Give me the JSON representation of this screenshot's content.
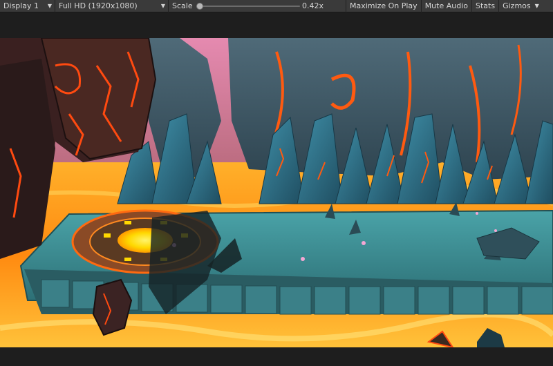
{
  "toolbar": {
    "display": "Display 1",
    "resolution": "Full HD (1920x1080)",
    "scale_label": "Scale",
    "scale_value": "0.42x",
    "scale_fraction": 0.0,
    "maximize_on_play": "Maximize On Play",
    "mute_audio": "Mute Audio",
    "stats": "Stats",
    "gizmos": "Gizmos"
  },
  "icons": {
    "dropdown": "chevron-down-icon"
  },
  "colors": {
    "toolbar_bg": "#3a3a3a",
    "editor_bg": "#1e1e1e",
    "lava": "#ff9a1a",
    "platform": "#3f8f95",
    "rune_glow": "#ffe600"
  }
}
